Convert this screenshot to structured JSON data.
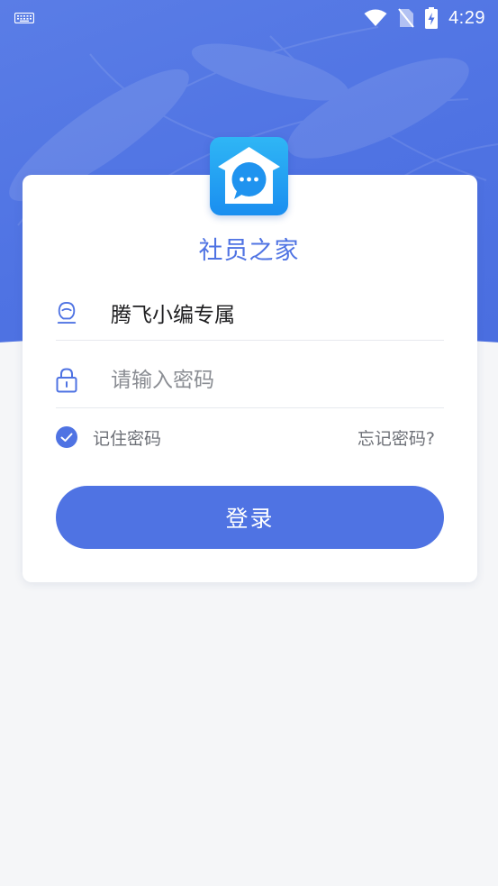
{
  "status_bar": {
    "time": "4:29",
    "icons": [
      "keyboard-icon",
      "wifi-icon",
      "no-sim-icon",
      "battery-charging-icon"
    ]
  },
  "app": {
    "title": "社员之家",
    "logo_icon": "chat-house-icon"
  },
  "form": {
    "username": {
      "icon": "user-icon",
      "value": "腾飞小编专属"
    },
    "password": {
      "icon": "lock-icon",
      "placeholder": "请输入密码",
      "value": ""
    },
    "remember_password": {
      "label": "记住密码",
      "checked": true
    },
    "forgot_password_label": "忘记密码?",
    "login_button_label": "登录"
  },
  "colors": {
    "primary": "#4f73e3",
    "logo_top": "#2fb6f5",
    "logo_bottom": "#1a8ef0",
    "background": "#f5f6f8",
    "card": "#ffffff",
    "muted_text": "#6d7077"
  }
}
